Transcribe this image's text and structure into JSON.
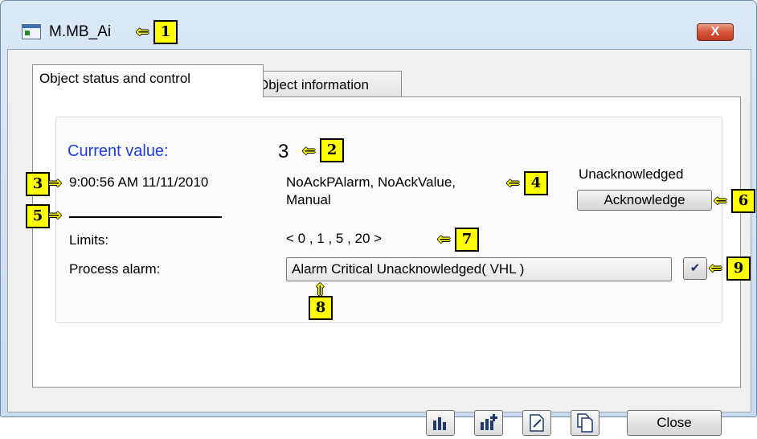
{
  "window": {
    "title": "M.MB_Ai",
    "close_glyph": "X"
  },
  "tabs": [
    {
      "label": "Object status and control"
    },
    {
      "label": "Object information"
    }
  ],
  "status": {
    "current_value_label": "Current value:",
    "current_value": "3",
    "timestamp": "9:00:56 AM 11/11/2010",
    "status_text_line1": "NoAckPAlarm, NoAckValue,",
    "status_text_line2": "Manual",
    "ack_state": "Unacknowledged",
    "acknowledge_button": "Acknowledge",
    "limits_label": "Limits:",
    "limits_value": "< 0 , 1 , 5 , 20 >",
    "process_alarm_label": "Process alarm:",
    "process_alarm_value": "Alarm Critical Unacknowledged( VHL )",
    "process_alarm_check_glyph": "✔"
  },
  "footer": {
    "close_button": "Close",
    "icons": [
      "trend-chart-icon",
      "add-trend-icon",
      "edit-document-icon",
      "copy-document-icon"
    ]
  },
  "callouts": [
    "1",
    "2",
    "3",
    "4",
    "5",
    "6",
    "7",
    "8",
    "9"
  ],
  "colors": {
    "current_value_label": "#1f3fe0",
    "callout_fill": "#ffff00"
  }
}
